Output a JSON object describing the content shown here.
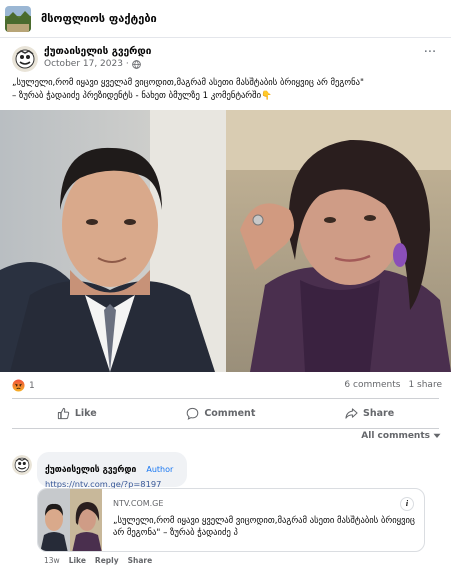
{
  "group": {
    "name": "მსოფლიოს ფაქტები",
    "thumb_icon": "group-landscape-thumbnail"
  },
  "post": {
    "author": "ქუთაისელის გვერდი",
    "date": "October 17, 2023 ·",
    "privacy_icon": "globe-icon",
    "more_label": "···",
    "text_line1": "„სულელი,რომ იყავი ყველამ ვიცოდით,მაგრამ ასეთი მასშტაბის ბრიყვიც არ მეგონა\"",
    "text_line2": "– ზურაბ ჭადაიძე პრეზიდენტს -  ნახეთ ბმულზე 1 კომენტარში👇"
  },
  "reactions": {
    "icon": "angry-reaction-icon",
    "count": "1",
    "comments": "6 comments",
    "shares": "1 share"
  },
  "actions": {
    "like": "Like",
    "comment": "Comment",
    "share": "Share"
  },
  "all_comments": "All comments",
  "comment": {
    "author": "ქუთაისელის გვერდი",
    "badge": "Author",
    "link": "https://ntv.com.ge/?p=8197",
    "card": {
      "domain": "NTV.COM.GE",
      "title": "„სულელი,რომ იყავი ყველამ ვიცოდით,მაგრამ ასეთი მასშტაბის ბრიყვიც არ მეგონა\" – ზურაბ ჭადაიძე პ",
      "info": "i"
    },
    "time": "13w",
    "like": "Like",
    "reply": "Reply",
    "share": "Share"
  },
  "colors": {
    "link": "#385898",
    "badge": "#1877f2",
    "muted": "#65676b",
    "bubble": "#f0f2f5"
  }
}
